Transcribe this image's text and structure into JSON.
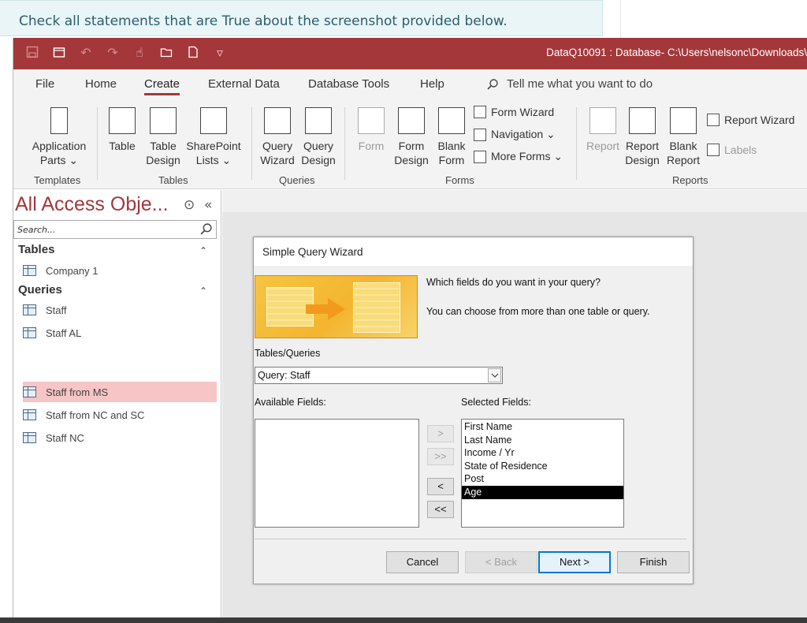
{
  "question": "Check all statements that are True about the screenshot provided below.",
  "window": {
    "title": "DataQ10091 : Database- C:\\Users\\nelsonc\\Downloads\\"
  },
  "menu": {
    "tabs": [
      "File",
      "Home",
      "Create",
      "External Data",
      "Database Tools",
      "Help"
    ],
    "active_tab": "Create",
    "tell_me": "Tell me what you want to do"
  },
  "ribbon": {
    "templates": {
      "label": "Templates",
      "app_parts": [
        "Application",
        "Parts ⌄"
      ]
    },
    "tables": {
      "label": "Tables",
      "table": "Table",
      "table_design": [
        "Table",
        "Design"
      ],
      "sharepoint": [
        "SharePoint",
        "Lists ⌄"
      ]
    },
    "queries": {
      "label": "Queries",
      "wizard": [
        "Query",
        "Wizard"
      ],
      "design": [
        "Query",
        "Design"
      ]
    },
    "forms": {
      "label": "Forms",
      "form": "Form",
      "form_design": [
        "Form",
        "Design"
      ],
      "blank_form": [
        "Blank",
        "Form"
      ],
      "form_wizard": "Form Wizard",
      "navigation": "Navigation ⌄",
      "more_forms": "More Forms ⌄"
    },
    "reports": {
      "label": "Reports",
      "report": "Report",
      "report_design": [
        "Report",
        "Design"
      ],
      "blank_report": [
        "Blank",
        "Report"
      ],
      "report_wizard": "Report Wizard",
      "labels": "Labels"
    }
  },
  "nav": {
    "title": "All Access Obje...",
    "search_placeholder": "Search...",
    "sections": [
      {
        "name": "Tables",
        "items": [
          "Company 1"
        ]
      },
      {
        "name": "Queries",
        "items": [
          "Staff",
          "Staff AL",
          "Staff from MS",
          "Staff from NC and SC",
          "Staff NC"
        ]
      }
    ],
    "selected_item": "Staff from MS"
  },
  "dialog": {
    "title": "Simple Query Wizard",
    "question1": "Which fields do you want in your query?",
    "question2": "You can choose from more than one table or query.",
    "tables_label": "Tables/Queries",
    "tables_value": "Query: Staff",
    "available_label": "Available Fields:",
    "selected_label": "Selected Fields:",
    "available_fields": [],
    "selected_fields": [
      "First Name",
      "Last Name",
      "Income / Yr",
      "State of Residence",
      "Post",
      "Age"
    ],
    "selected_highlight": "Age",
    "move_buttons": [
      ">",
      ">>",
      "<",
      "<<"
    ],
    "buttons": {
      "cancel": "Cancel",
      "back": "< Back",
      "next": "Next >",
      "finish": "Finish"
    }
  }
}
